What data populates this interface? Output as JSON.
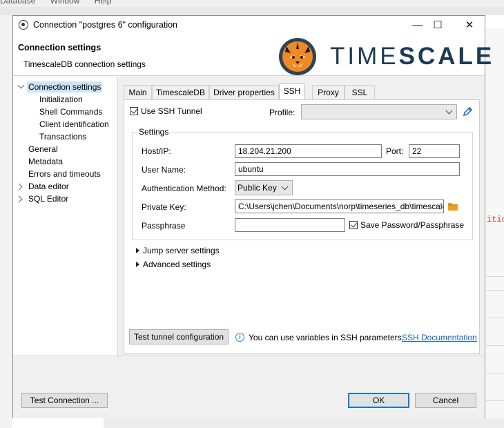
{
  "background": {
    "menu": [
      "Database",
      "Window",
      "Help"
    ],
    "side_text_right": "itio"
  },
  "window": {
    "title": "Connection \"postgres 6\" configuration",
    "controls": [
      "minimize",
      "maximize",
      "close"
    ]
  },
  "header": {
    "title": "Connection settings",
    "subtitle": "TimescaleDB connection settings",
    "brand_light": "TIME",
    "brand_bold": "SCALE"
  },
  "tree": {
    "items": [
      {
        "label": "Connection settings",
        "selected": true,
        "expanded": true
      },
      {
        "label": "Initialization"
      },
      {
        "label": "Shell Commands"
      },
      {
        "label": "Client identification"
      },
      {
        "label": "Transactions"
      },
      {
        "label": "General"
      },
      {
        "label": "Metadata"
      },
      {
        "label": "Errors and timeouts"
      },
      {
        "label": "Data editor",
        "collapsed": true
      },
      {
        "label": "SQL Editor",
        "collapsed": true
      }
    ]
  },
  "tabs": [
    "Main",
    "TimescaleDB",
    "Driver properties",
    "SSH",
    "Proxy",
    "SSL"
  ],
  "active_tab": "SSH",
  "ssh": {
    "use_tunnel_label": "Use SSH Tunnel",
    "use_tunnel_checked": true,
    "profile_label": "Profile:",
    "profile_value": "",
    "settings_title": "Settings",
    "host_label": "Host/IP:",
    "host_value": "18.204.21.200",
    "port_label": "Port:",
    "port_value": "22",
    "user_label": "User Name:",
    "user_value": "ubuntu",
    "auth_label": "Authentication Method:",
    "auth_value": "Public Key",
    "key_label": "Private Key:",
    "key_value": "C:\\Users\\jchen\\Documents\\norp\\timeseries_db\\timescale",
    "pass_label": "Passphrase",
    "pass_value": "",
    "save_pass_label": "Save Password/Passphrase",
    "save_pass_checked": true,
    "jump_label": "Jump server settings",
    "advanced_label": "Advanced settings",
    "test_tunnel_label": "Test tunnel configuration",
    "info_text": "You can use variables in SSH parameters.",
    "doc_link": "SSH Documentation"
  },
  "footer": {
    "test_connection": "Test Connection ...",
    "ok": "OK",
    "cancel": "Cancel"
  },
  "colors": {
    "accent": "#0078d7",
    "selection": "#cce4f7",
    "link": "#1a5fb4",
    "folder": "#e8a21c",
    "brand": "#1b3a55"
  }
}
